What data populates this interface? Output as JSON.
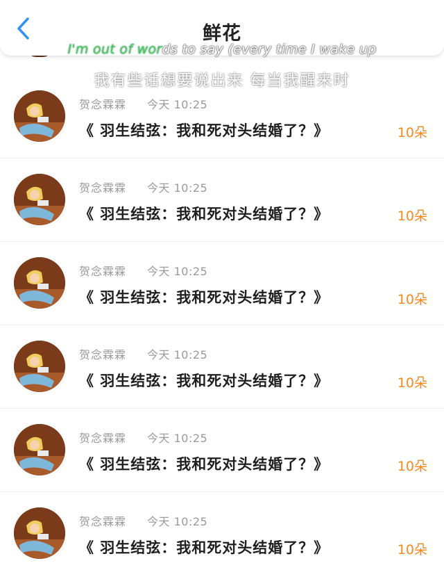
{
  "header": {
    "title": "鲜花",
    "back_icon": "chevron-left-icon",
    "accent_color": "#2e93f5"
  },
  "lyrics": {
    "en_highlight": "I'm out of wor",
    "en_rest": "ds to say (every time I wake up",
    "zh": "我有些话想要说出来 每当我醒来时",
    "highlight_color": "#4cc96a"
  },
  "list": {
    "items": [
      {
        "sender": "贺念霖霖",
        "time": "今天 10:25",
        "title": "《 羽生结弦：我和死对头结婚了？》",
        "count": "10朵"
      },
      {
        "sender": "贺念霖霖",
        "time": "今天 10:25",
        "title": "《 羽生结弦：我和死对头结婚了？》",
        "count": "10朵"
      },
      {
        "sender": "贺念霖霖",
        "time": "今天 10:25",
        "title": "《 羽生结弦：我和死对头结婚了？》",
        "count": "10朵"
      },
      {
        "sender": "贺念霖霖",
        "time": "今天 10:25",
        "title": "《 羽生结弦：我和死对头结婚了？》",
        "count": "10朵"
      },
      {
        "sender": "贺念霖霖",
        "time": "今天 10:25",
        "title": "《 羽生结弦：我和死对头结婚了？》",
        "count": "10朵"
      },
      {
        "sender": "贺念霖霖",
        "time": "今天 10:25",
        "title": "《 羽生结弦：我和死对头结婚了？》",
        "count": "10朵"
      }
    ],
    "count_color": "#f08a1f"
  }
}
